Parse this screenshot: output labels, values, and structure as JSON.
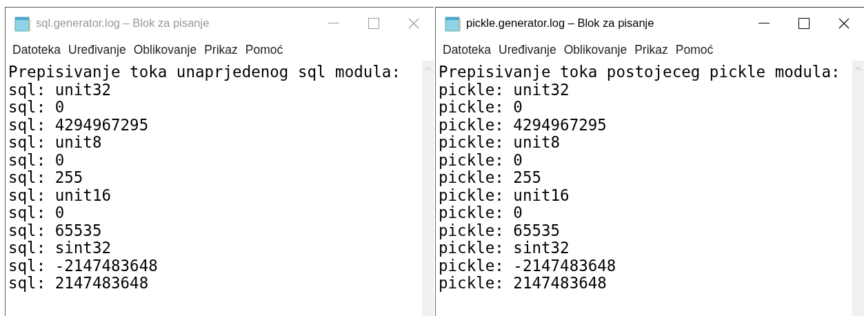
{
  "windows": [
    {
      "title": "sql.generator.log – Blok za pisanje",
      "active": false,
      "menu": [
        "Datoteka",
        "Uređivanje",
        "Oblikovanje",
        "Prikaz",
        "Pomoć"
      ],
      "lines": [
        "Prepisivanje toka unaprjedenog sql modula:",
        "sql: unit32",
        "sql: 0",
        "sql: 4294967295",
        "sql: unit8",
        "sql: 0",
        "sql: 255",
        "sql: unit16",
        "sql: 0",
        "sql: 65535",
        "sql: sint32",
        "sql: -2147483648",
        "sql: 2147483648"
      ]
    },
    {
      "title": "pickle.generator.log – Blok za pisanje",
      "active": true,
      "menu": [
        "Datoteka",
        "Uređivanje",
        "Oblikovanje",
        "Prikaz",
        "Pomoć"
      ],
      "lines": [
        "Prepisivanje toka postojeceg pickle modula:",
        "pickle: unit32",
        "pickle: 0",
        "pickle: 4294967295",
        "pickle: unit8",
        "pickle: 0",
        "pickle: 255",
        "pickle: unit16",
        "pickle: 0",
        "pickle: 65535",
        "pickle: sint32",
        "pickle: -2147483648",
        "pickle: 2147483648"
      ]
    }
  ]
}
